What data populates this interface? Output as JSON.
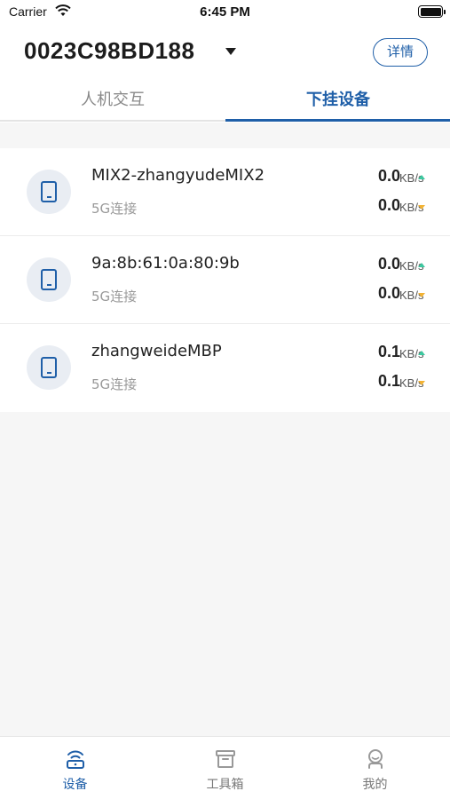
{
  "status_bar": {
    "carrier": "Carrier",
    "time": "6:45 PM"
  },
  "header": {
    "device_id": "0023C98BD188",
    "detail_button": "详情",
    "tabs": [
      {
        "label": "人机交互",
        "active": false
      },
      {
        "label": "下挂设备",
        "active": true
      }
    ]
  },
  "devices": [
    {
      "name": "MIX2-zhangyudeMIX2",
      "connection": "5G连接",
      "upload": "0.0",
      "download": "0.0",
      "unit": "KB/s"
    },
    {
      "name": "9a:8b:61:0a:80:9b",
      "connection": "5G连接",
      "upload": "0.0",
      "download": "0.0",
      "unit": "KB/s"
    },
    {
      "name": "zhangweideMBP",
      "connection": "5G连接",
      "upload": "0.1",
      "download": "0.1",
      "unit": "KB/s"
    }
  ],
  "tabbar": {
    "items": [
      {
        "label": "设备",
        "icon": "router-icon",
        "active": true
      },
      {
        "label": "工具箱",
        "icon": "toolbox-icon",
        "active": false
      },
      {
        "label": "我的",
        "icon": "profile-icon",
        "active": false
      }
    ]
  },
  "colors": {
    "accent": "#1f5fa8",
    "upload_arrow": "#3cc9a0",
    "download_arrow": "#f2b233"
  }
}
